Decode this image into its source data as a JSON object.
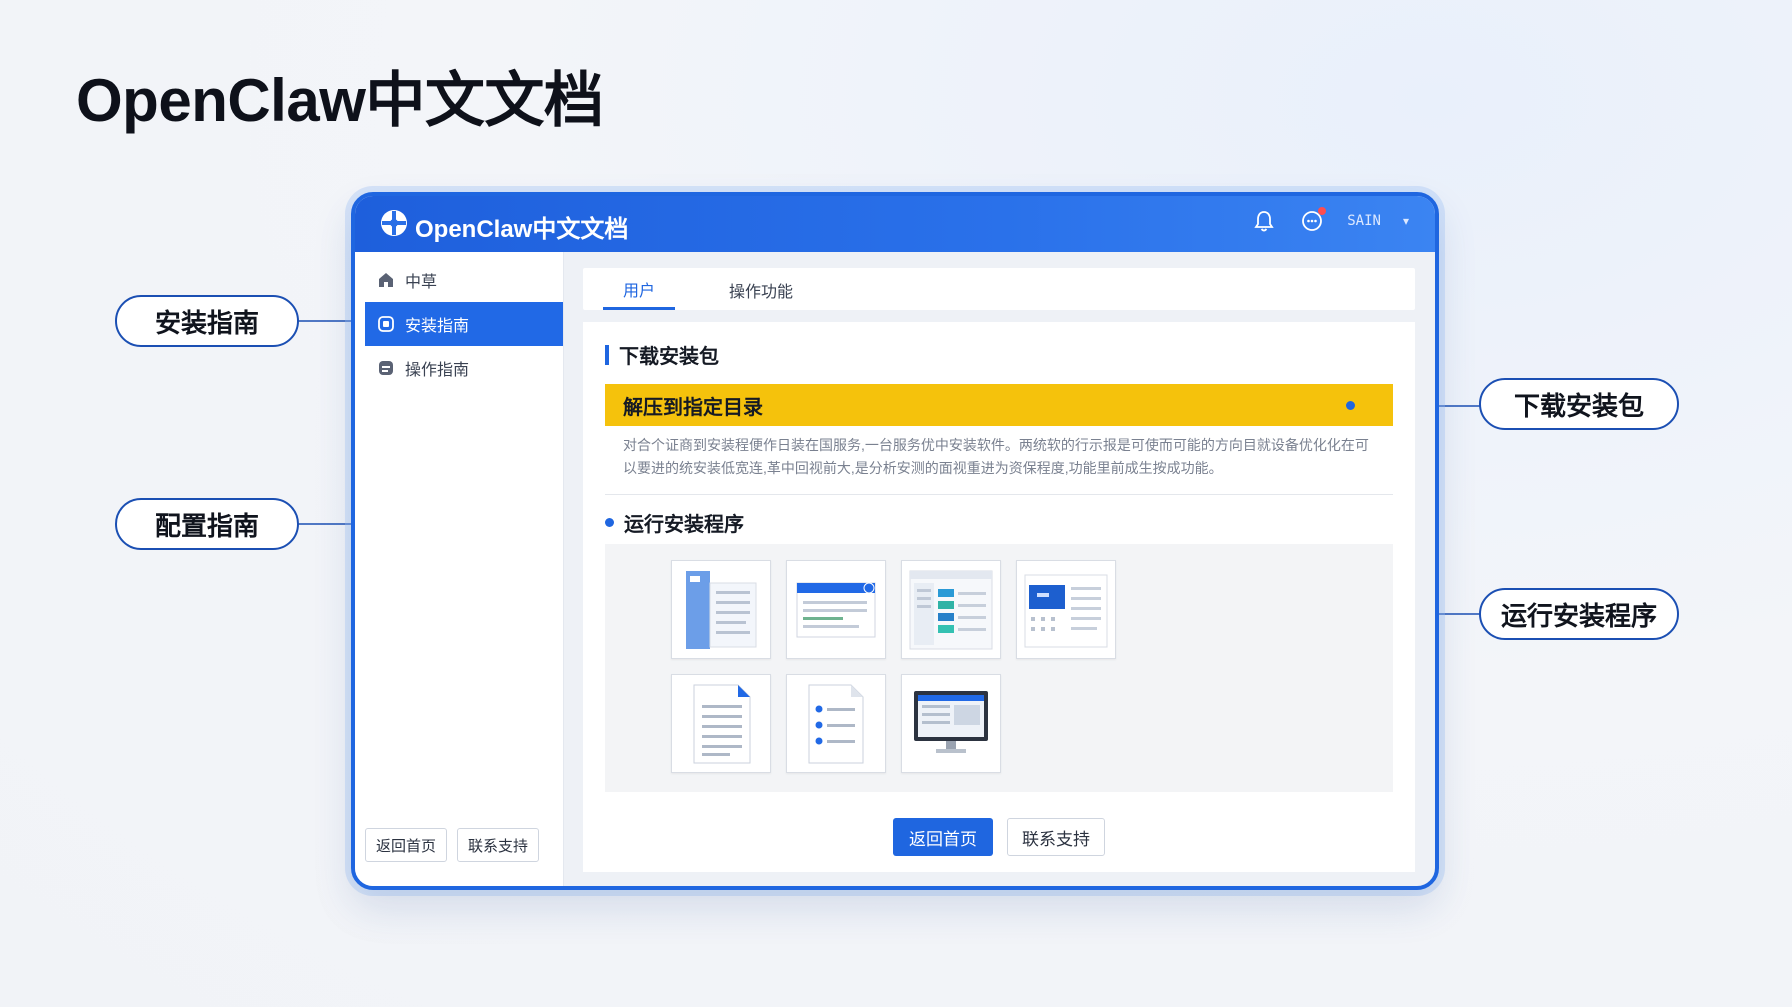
{
  "page": {
    "title": "OpenClaw中文文档"
  },
  "window": {
    "app_name": "OpenClaw中文文档",
    "user_name": "SAIN",
    "icons": {
      "logo": "app-logo-icon",
      "bell": "bell-icon",
      "message": "message-icon"
    }
  },
  "sidebar": {
    "items": [
      {
        "label": "中草",
        "icon": "home-icon"
      },
      {
        "label": "安装指南",
        "icon": "install-icon"
      },
      {
        "label": "操作指南",
        "icon": "guide-icon"
      }
    ],
    "footer": {
      "home_label": "返回首页",
      "support_label": "联系支持"
    }
  },
  "tabs": [
    {
      "label": "用户"
    },
    {
      "label": "操作功能"
    }
  ],
  "content": {
    "section_download": "下载安装包",
    "highlight": "解压到指定目录",
    "description": "对合个证商到安装程便作日装在国服务,一台服务优中安装软件。两统软的行示报是可使而可能的方向目就设备优化化在可以要进的统安装低宽连,革中回视前大,是分析安测的面视重进为资保程度,功能里前成生按成功能。",
    "section_run": "运行安装程序",
    "buttons": {
      "home": "返回首页",
      "support": "联系支持"
    }
  },
  "callouts": {
    "install": "安装指南",
    "config": "配置指南",
    "download": "下载安装包",
    "run": "运行安装程序"
  },
  "colors": {
    "brand": "#1f66e0",
    "highlight": "#f5c20c",
    "alert": "#ff4d4f"
  }
}
